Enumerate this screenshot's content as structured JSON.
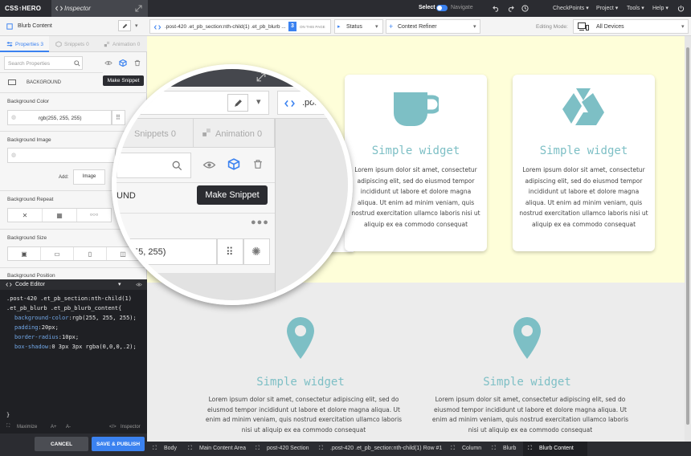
{
  "app": {
    "logo": "CSS↑HERO",
    "inspector_tab": "Inspector",
    "select_label": "Select",
    "navigate_label": "Navigate",
    "menu": [
      "CheckPoints ▾",
      "Project ▾",
      "Tools ▾",
      "Help ▾"
    ]
  },
  "toolbar": {
    "element_selector": "Blurb Content",
    "selector_path": ".post-420 .et_pb_section:nth-child(1) .et_pb_blurb ...",
    "on_page_count": "3",
    "on_page_label": "ON THIS PAGE",
    "status_label": "Status",
    "context_refiner": "Context Refiner",
    "editing_mode_label": "Editing Mode:",
    "device_value": "All Devices"
  },
  "panel": {
    "tabs": [
      "Properties 3",
      "Snippets 0",
      "Animation 0"
    ],
    "search_placeholder": "Search Properties",
    "tooltip": "Make Snippet",
    "group": "BACKGROUND",
    "bg_color_label": "Background Color",
    "bg_color_value": "rgb(255, 255, 255)",
    "bg_image_label": "Background Image",
    "add_label": "Add:",
    "image_button": "Image",
    "bg_repeat_label": "Background Repeat",
    "bg_size_label": "Background Size",
    "bg_position_label": "Background Position"
  },
  "code_editor": {
    "title": "Code Editor",
    "selector_line1": ".post-420 .et_pb_section:nth-child(1)",
    "selector_line2": ".et_pb_blurb .et_pb_blurb_content{",
    "props": [
      {
        "name": "background-color",
        "value": "rgb(255, 255, 255);"
      },
      {
        "name": "padding",
        "value": "20px;"
      },
      {
        "name": "border-radius",
        "value": "10px;"
      },
      {
        "name": "box-shadow",
        "value": "0 3px 3px rgba(0,0,0,.2);"
      }
    ],
    "closing": "}",
    "maximize": "Maximize",
    "font_up": "A+",
    "font_down": "A-",
    "inspector": "Inspector"
  },
  "actions": {
    "cancel": "CANCEL",
    "save": "SAVE & PUBLISH"
  },
  "widgets": {
    "title": "Simple widget",
    "text_short": "Lorem ipsum dolor sit amet, consectetur adipiscing elit, sed do eiusmod tempor incididunt ut labore et dolore magna aliqua. Ut enim ad minim veniam, quis nostrud exercitation ullamco laboris nisi ut aliquip ex ea commodo consequat",
    "text_long": "Lorem ipsum dolor sit amet, consectetur adipiscing elit, sed do eiusmod tempor incididunt ut labore et dolore magna aliqua. Ut enim ad minim veniam, quis nostrud exercitation ullamco laboris nisi ut aliquip ex ea commodo consequat",
    "accent_color": "#7dbfc5"
  },
  "magnifier": {
    "snippets_tab": "Snippets 0",
    "animation_tab": "Animation 0",
    "path_fragment": ".post-",
    "group_fragment": "UND",
    "value_fragment": "55, 255)",
    "tooltip": "Make Snippet"
  },
  "breadcrumbs": [
    "Body",
    "Main Content Area",
    "post-420 Section",
    ".post-420 .et_pb_section:nth-child(1) Row #1",
    "Column",
    "Blurb",
    "Blurb Content"
  ],
  "colors": {
    "primary_blue": "#3b82f0",
    "dark_bar": "#2b2c31",
    "canvas_yellow": "#fefed9"
  }
}
